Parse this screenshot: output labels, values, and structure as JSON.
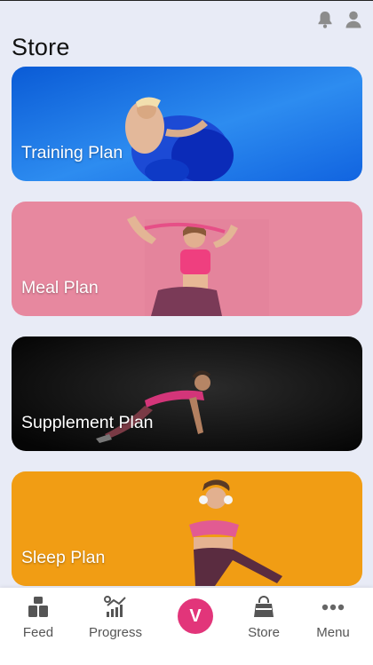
{
  "header": {
    "title": "Store",
    "icons": [
      "bell-icon",
      "user-icon"
    ]
  },
  "plans": [
    {
      "label": "Training Plan",
      "bg_color": "#2a78e8"
    },
    {
      "label": "Meal Plan",
      "bg_color": "#e7879f"
    },
    {
      "label": "Supplement Plan",
      "bg_color": "#111111"
    },
    {
      "label": "Sleep Plan",
      "bg_color": "#f09a12"
    }
  ],
  "nav": {
    "items": [
      {
        "label": "Feed",
        "icon": "feed-icon"
      },
      {
        "label": "Progress",
        "icon": "progress-chart-icon"
      },
      {
        "label": "V",
        "icon": "brand-logo"
      },
      {
        "label": "Store",
        "icon": "shopping-bag-icon"
      },
      {
        "label": "Menu",
        "icon": "more-dots-icon"
      }
    ],
    "accent": "#e2357a"
  }
}
